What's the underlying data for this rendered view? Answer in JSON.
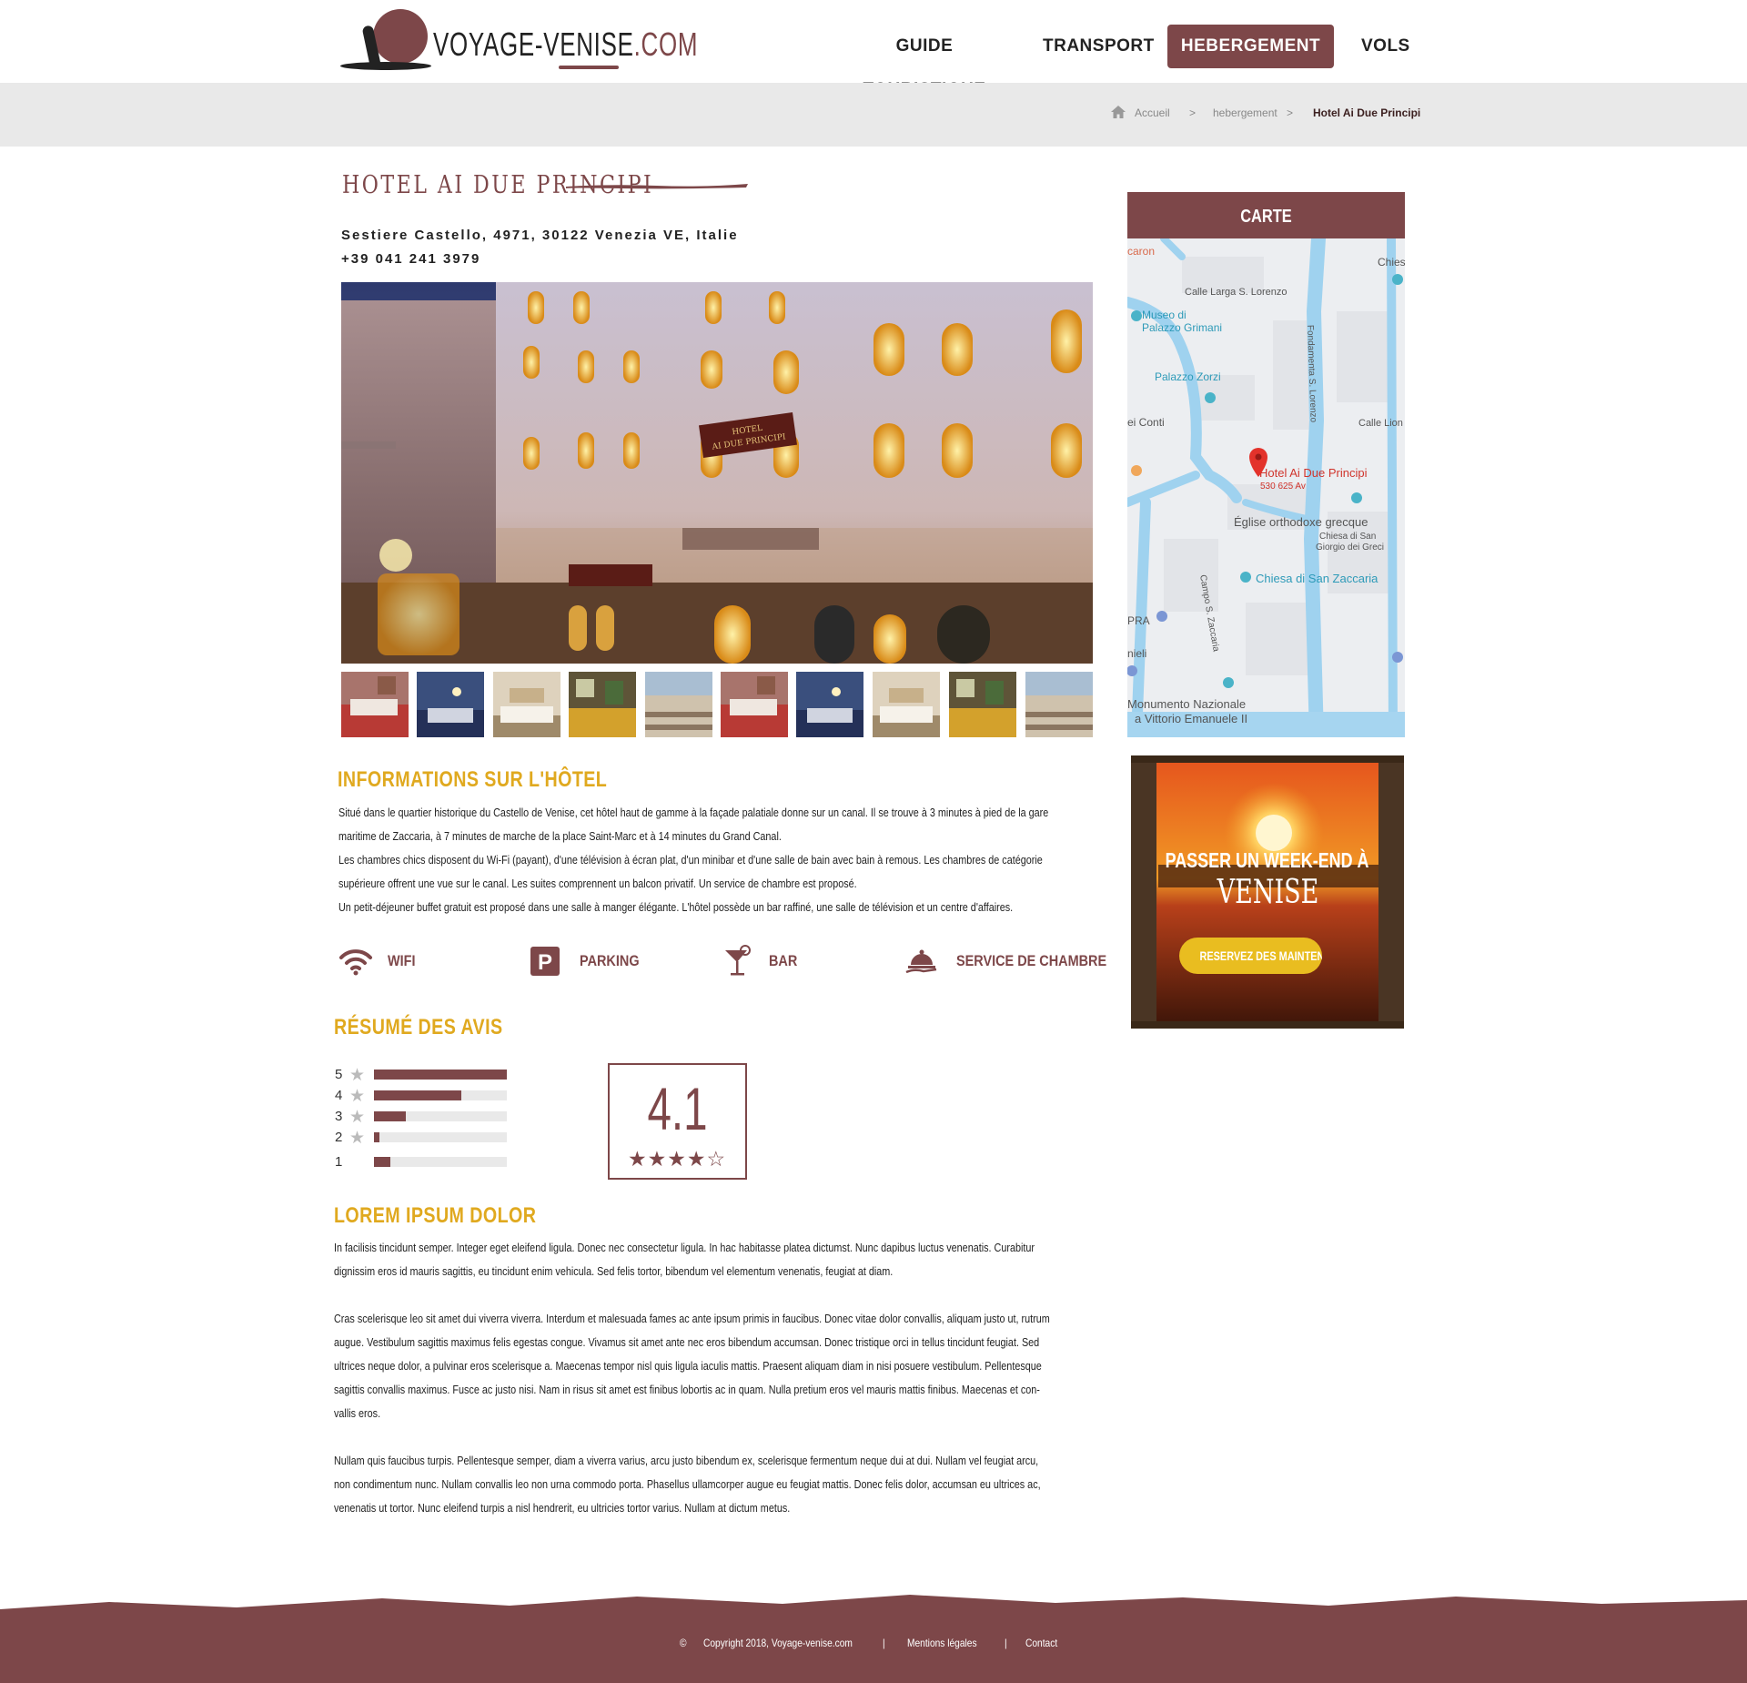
{
  "site": {
    "logo_text_main": "VOYAGE-VENISE",
    "logo_text_domain": ".COM"
  },
  "nav": {
    "items": [
      {
        "label": "GUIDE TOURISTIQUE"
      },
      {
        "label": "TRANSPORT"
      },
      {
        "label": "HEBERGEMENT",
        "active": true
      },
      {
        "label": "VOLS"
      }
    ]
  },
  "breadcrumb": {
    "home_icon": "home-icon",
    "items": [
      "Accueil",
      "hebergement",
      "Hotel Ai Due Principi"
    ],
    "separator": ">"
  },
  "hotel": {
    "name": "HOTEL AI DUE PRINCIPI",
    "address": "Sestiere Castello, 4971, 30122 Venezia VE, Italie",
    "phone": "+39 041 241 3979",
    "photo_sign": "HOTEL AI DUE PRINCIPI"
  },
  "info": {
    "heading": "INFORMATIONS SUR L'HÔTEL",
    "lines": [
      "Situé dans le quartier historique du Castello de Venise, cet hôtel haut de gamme à la façade palatiale donne sur un canal. Il se trouve à 3 minutes à pied de la gare",
      "maritime de Zaccaria, à 7 minutes de marche de la place Saint-Marc et à 14 minutes du Grand Canal.",
      "Les chambres chics disposent du Wi-Fi (payant), d'une télévision à écran plat, d'un minibar et d'une salle de bain avec bain à remous. Les chambres de catégorie",
      "supérieure offrent une vue sur le canal. Les suites comprennent un balcon privatif. Un service de chambre est proposé.",
      "Un petit-déjeuner buffet gratuit est proposé dans une salle à manger élégante. L'hôtel possède un bar raffiné, une salle de télévision et un centre d'affaires."
    ]
  },
  "amenities": [
    {
      "label": "WIFI",
      "icon": "wifi-icon"
    },
    {
      "label": "PARKING",
      "icon": "parking-icon"
    },
    {
      "label": "BAR",
      "icon": "cocktail-icon"
    },
    {
      "label": "SERVICE DE CHAMBRE",
      "icon": "room-service-icon"
    }
  ],
  "reviews": {
    "heading": "RÉSUMÉ DES AVIS",
    "score": "4.1",
    "stars": "★★★★☆",
    "rows": [
      {
        "label": "5",
        "fraction": 1.0,
        "star": "★"
      },
      {
        "label": "4",
        "fraction": 0.66,
        "star": "★"
      },
      {
        "label": "3",
        "fraction": 0.24,
        "star": "★"
      },
      {
        "label": "2",
        "fraction": 0.04,
        "star": "★"
      },
      {
        "label": "1",
        "fraction": 0.12,
        "star": ""
      }
    ]
  },
  "lorem": {
    "heading": "LOREM IPSUM DOLOR",
    "paragraphs": [
      [
        "In facilisis tincidunt semper. Integer eget eleifend ligula. Donec nec consectetur ligula. In hac habitasse platea dictumst. Nunc dapibus luctus venenatis. Curabitur",
        "dignissim eros id mauris sagittis, eu tincidunt enim vehicula. Sed felis tortor, bibendum vel elementum venenatis, feugiat at diam."
      ],
      [
        "Cras scelerisque leo sit amet dui viverra viverra. Interdum et malesuada fames ac ante ipsum primis in faucibus. Donec vitae dolor convallis, aliquam justo ut, rutrum",
        "augue. Vestibulum sagittis maximus felis egestas congue. Vivamus sit amet ante nec eros bibendum accumsan. Donec tristique orci in tellus tincidunt feugiat. Sed",
        "ultrices neque dolor, a pulvinar eros scelerisque a. Maecenas tempor nisl quis ligula iaculis mattis. Praesent aliquam diam in nisi posuere vestibulum. Pellentesque",
        "sagittis convallis maximus. Fusce ac justo nisi. Nam in risus sit amet est finibus lobortis ac in quam. Nulla pretium eros vel mauris mattis finibus. Maecenas et con-",
        "vallis eros."
      ],
      [
        "Nullam quis faucibus turpis. Pellentesque semper, diam a viverra varius, arcu justo bibendum ex, scelerisque fermentum neque dui at dui. Nullam vel feugiat arcu,",
        "non condimentum nunc. Nullam convallis leo non urna commodo porta. Phasellus ullamcorper augue eu feugiat mattis. Donec felis dolor, accumsan eu ultrices ac,",
        "venenatis ut tortor. Nunc eleifend turpis a nisl hendrerit, eu ultricies tortor varius. Nullam at dictum metus."
      ]
    ]
  },
  "sidebar": {
    "map_title": "CARTE",
    "map_labels": {
      "caron": "caron",
      "chies": "Chies",
      "calle_larga": "Calle Larga S. Lorenzo",
      "museo": "Museo di",
      "museo2": "Palazzo Grimani",
      "fondamenta": "Fondamenta S. Lorenzo",
      "zorzi": "Palazzo Zorzi",
      "conti": "ei Conti",
      "calle_lion": "Calle Lion",
      "hotel": "Hotel Ai Due Principi",
      "reviews": "530 625 Av",
      "eglise": "Église orthodoxe grecque",
      "chiesa_greci1": "Chiesa di San",
      "chiesa_greci2": "Giorgio dei Greci",
      "campo": "Campo S. Zaccaria",
      "zaccaria": "Chiesa di San Zaccaria",
      "pra": "PRA",
      "nieli": "nieli",
      "monumento1": "Monumento Nazionale",
      "monumento2": "a Vittorio Emanuele II"
    },
    "promo": {
      "line1": "PASSER UN WEEK-END À",
      "line2": "VENISE",
      "button": "RESERVEZ DES MAINTENANT"
    }
  },
  "footer": {
    "copyright": "Copyright 2018, Voyage-venise.com",
    "copyright_icon": "copyright-icon",
    "sep": "|",
    "mentions": "Mentions légales",
    "contact": "Contact"
  },
  "colors": {
    "brand": "#7d4749",
    "accent": "#e0a91f",
    "breadcrumb_bg": "#e9e9e9"
  }
}
